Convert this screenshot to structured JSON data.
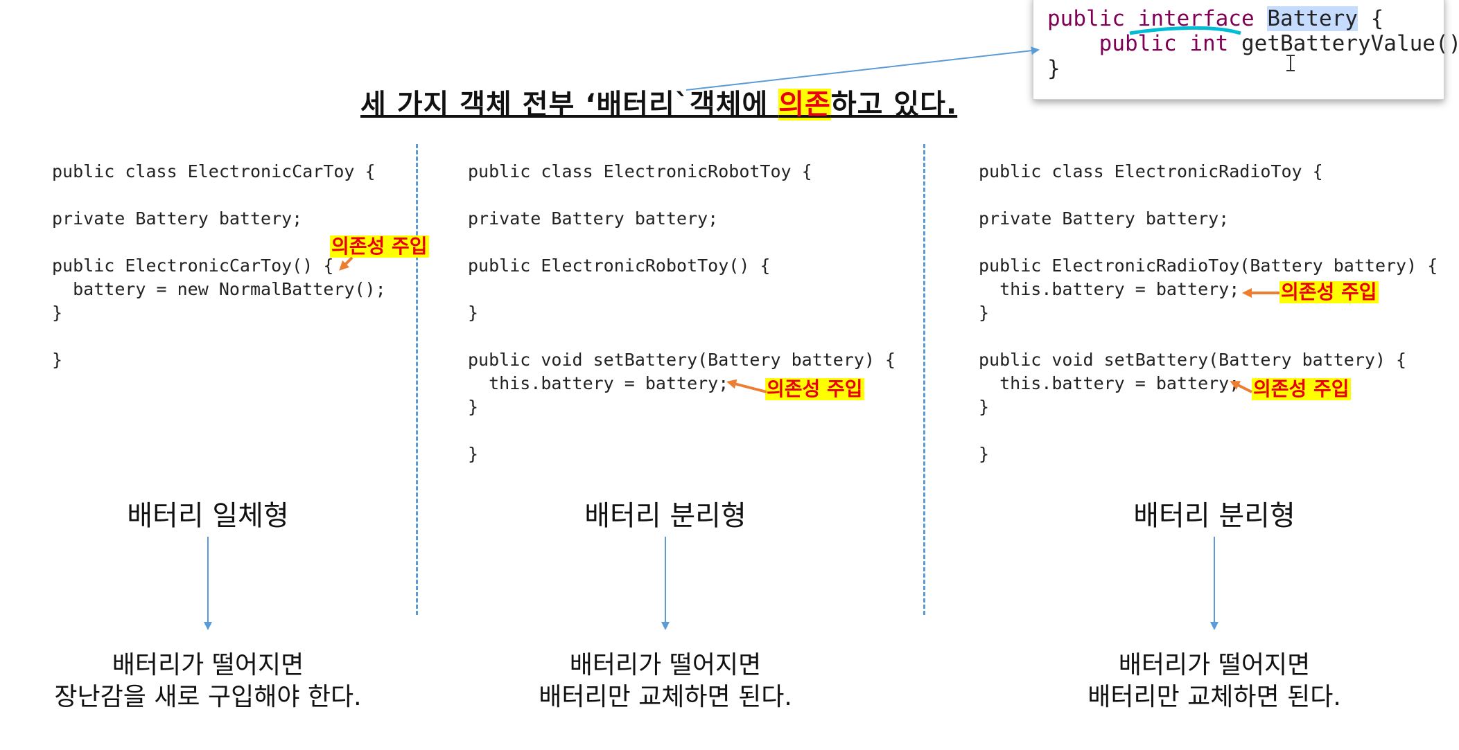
{
  "title": {
    "part1": "세 가지 객체 전부 ‘배터리`객체에 ",
    "highlight": "의존",
    "part2": "하고 있다."
  },
  "popup": {
    "public": "public",
    "interface": "interface",
    "name": "Battery",
    "brace_open": "{",
    "line2_public": "public",
    "line2_int": "int",
    "line2_method": "getBatteryValue();",
    "brace_close": "}"
  },
  "panels": {
    "car": {
      "class_line": "public class ElectronicCarToy {",
      "field_line": "private Battery battery;",
      "ctor_line": "public ElectronicCarToy() {",
      "body_line": "battery = new NormalBattery();",
      "close1": "}",
      "close2": "}",
      "inject_label": "의존성 주입",
      "caption": "배터리 일체형",
      "desc1": "배터리가 떨어지면",
      "desc2": "장난감을 새로 구입해야 한다."
    },
    "robot": {
      "class_line": "public class ElectronicRobotToy {",
      "field_line": "private Battery battery;",
      "ctor_line": "public ElectronicRobotToy() {",
      "close_ctor": "}",
      "setter_line": "public void setBattery(Battery battery) {",
      "setter_body": "this.battery = battery;",
      "close_setter": "}",
      "close_class": "}",
      "inject_label": "의존성 주입",
      "caption": "배터리 분리형",
      "desc1": "배터리가 떨어지면",
      "desc2": "배터리만 교체하면 된다."
    },
    "radio": {
      "class_line": "public class ElectronicRadioToy {",
      "field_line": "private Battery battery;",
      "ctor_line": "public ElectronicRadioToy(Battery battery) {",
      "ctor_body": "this.battery = battery;",
      "close_ctor": "}",
      "setter_line": "public void setBattery(Battery battery) {",
      "setter_body": "this.battery = battery;",
      "close_setter": "}",
      "close_class": "}",
      "inject_label_1": "의존성 주입",
      "inject_label_2": "의존성 주입",
      "caption": "배터리 분리형",
      "desc1": "배터리가 떨어지면",
      "desc2": "배터리만 교체하면 된다."
    }
  },
  "colors": {
    "keyword": "#7f0055",
    "field": "#0000c0",
    "highlight_bg": "#ffff00",
    "highlight_text": "#e8000d",
    "arrow_orange": "#ed7d31",
    "arrow_blue": "#5b9bd5"
  }
}
